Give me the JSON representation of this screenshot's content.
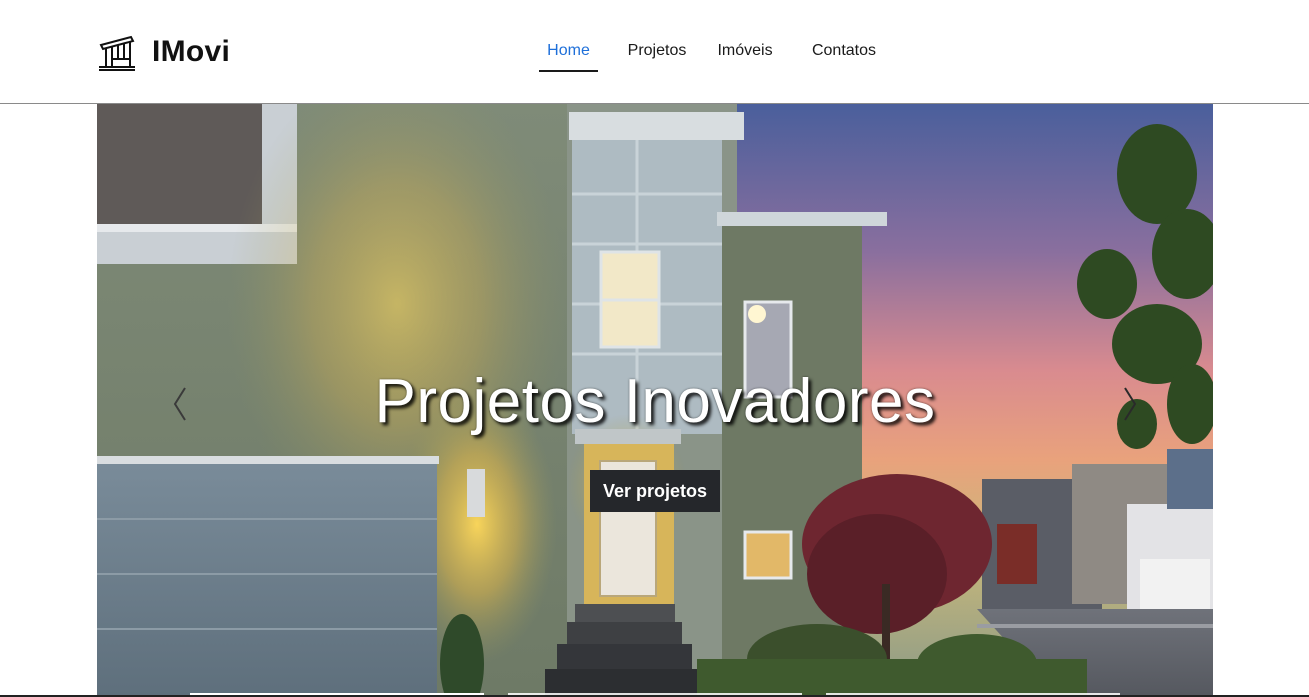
{
  "brand": {
    "name": "IMovi",
    "icon": "house-icon"
  },
  "nav": {
    "items": [
      {
        "label": "Home",
        "active": true
      },
      {
        "label": "Projetos",
        "active": false
      },
      {
        "label": "Imóveis",
        "active": false
      },
      {
        "label": "Contatos",
        "active": false
      }
    ]
  },
  "hero": {
    "title": "Projetos Inovadores",
    "button_label": "Ver projetos",
    "prev_icon": "chevron-left-icon",
    "next_icon": "chevron-right-icon",
    "slide_count": 3,
    "active_slide": 1
  },
  "colors": {
    "accent": "#1e6fd9",
    "button_bg": "#25272b",
    "text": "#1a1a1a"
  }
}
